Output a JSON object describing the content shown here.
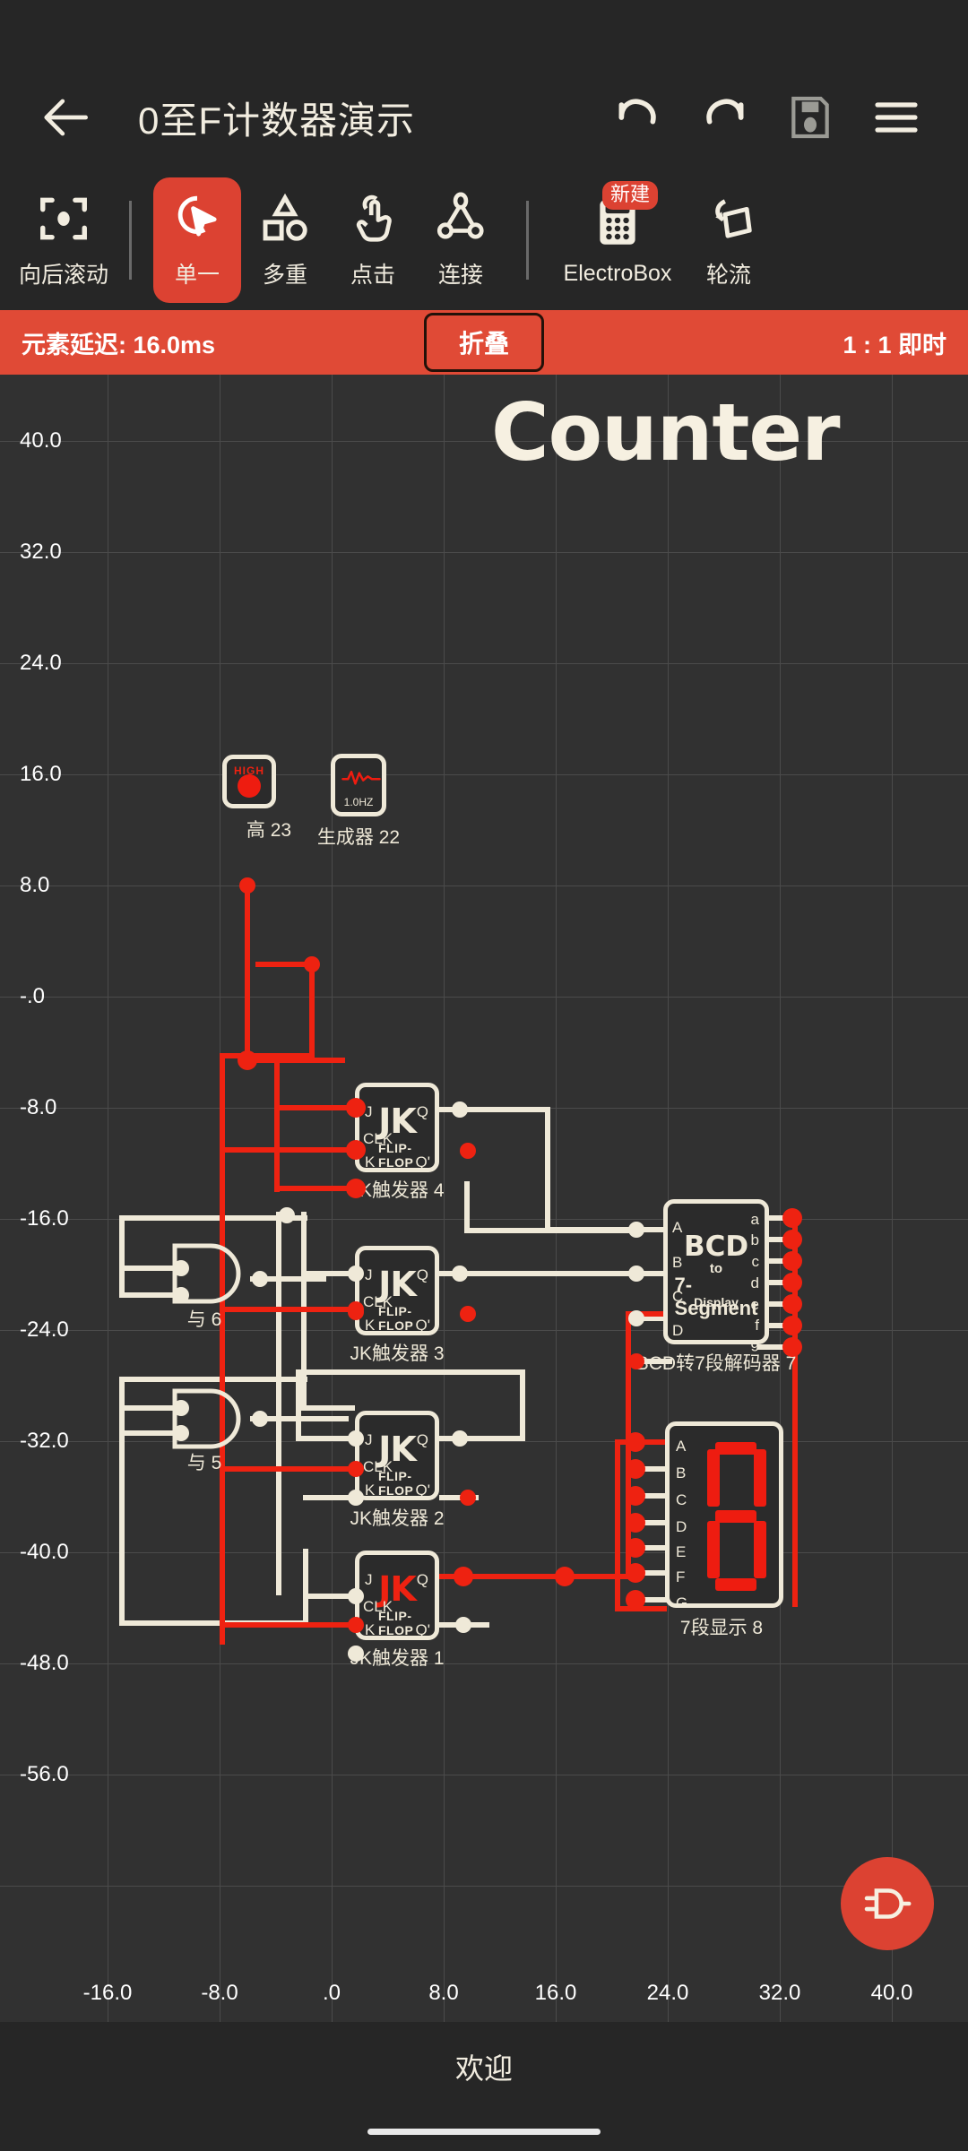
{
  "titlebar": {
    "back_icon": "arrow-left-icon",
    "title": "0至F计数器演示",
    "undo_icon": "undo-icon",
    "redo_icon": "redo-icon",
    "save_icon": "save-icon",
    "menu_icon": "hamburger-menu-icon"
  },
  "toolbar": {
    "items": [
      {
        "label": "向后滚动",
        "icon": "focus-frame-icon",
        "selected": false
      },
      {
        "label": "单一",
        "icon": "single-select-cursor-icon",
        "selected": true
      },
      {
        "label": "多重",
        "icon": "multi-shapes-icon",
        "selected": false
      },
      {
        "label": "点击",
        "icon": "tap-hand-icon",
        "selected": false
      },
      {
        "label": "连接",
        "icon": "connect-nodes-icon",
        "selected": false
      },
      {
        "label": "ElectroBox",
        "icon": "calculator-icon",
        "selected": false,
        "badge": "新建"
      },
      {
        "label": "轮流",
        "icon": "rotate-icon",
        "selected": false
      }
    ]
  },
  "simbar": {
    "delay_text": "元素延迟: 16.0ms",
    "collapse_label": "折叠",
    "rate_text": "1 : 1 即时",
    "bg_color": "#e04a36"
  },
  "canvas": {
    "sheet_title": "Counter",
    "accent_color": "#dc4232",
    "wire_color": "#efe9d8",
    "hot_color": "#ee2211",
    "y_ticks": [
      "40.0",
      "32.0",
      "24.0",
      "16.0",
      "8.0",
      "-.0",
      "-8.0",
      "-16.0",
      "-24.0",
      "-32.0",
      "-40.0",
      "-48.0",
      "-56.0"
    ],
    "x_ticks": [
      "-16.0",
      "-8.0",
      ".0",
      "8.0",
      "16.0",
      "24.0",
      "32.0",
      "40.0"
    ],
    "components": [
      {
        "name": "高 23",
        "type": "high-source",
        "badge_text": "HIGH"
      },
      {
        "name": "生成器 22",
        "type": "clock-generator",
        "freq": "1.0HZ"
      },
      {
        "name": "JK触发器 4",
        "type": "jk-flip-flop",
        "title": "JK",
        "subtitle": "FLIP-FLOP",
        "inputs": [
          "J",
          "CLK",
          "K"
        ],
        "outputs": [
          "Q",
          "Q'"
        ],
        "active": false
      },
      {
        "name": "JK触发器 3",
        "type": "jk-flip-flop",
        "title": "JK",
        "subtitle": "FLIP-FLOP",
        "inputs": [
          "J",
          "CLK",
          "K"
        ],
        "outputs": [
          "Q",
          "Q'"
        ],
        "active": false
      },
      {
        "name": "JK触发器 2",
        "type": "jk-flip-flop",
        "title": "JK",
        "subtitle": "FLIP-FLOP",
        "inputs": [
          "J",
          "CLK",
          "K"
        ],
        "outputs": [
          "Q",
          "Q'"
        ],
        "active": false
      },
      {
        "name": "JK触发器 1",
        "type": "jk-flip-flop",
        "title": "JK",
        "subtitle": "FLIP-FLOP",
        "inputs": [
          "J",
          "CLK",
          "K"
        ],
        "outputs": [
          "Q",
          "Q'"
        ],
        "active": true
      },
      {
        "name": "与 6",
        "type": "and-gate"
      },
      {
        "name": "与 5",
        "type": "and-gate"
      },
      {
        "name": "BCD转7段解码器 7",
        "type": "bcd-decoder",
        "line1": "BCD",
        "line2": "to",
        "line3": "7-Segment",
        "line4": "Display",
        "inputs": [
          "A",
          "B",
          "C",
          "D"
        ],
        "outputs": [
          "a",
          "b",
          "c",
          "d",
          "e",
          "f",
          "g"
        ]
      },
      {
        "name": "7段显示 8",
        "type": "seven-segment-display",
        "inputs": [
          "A",
          "B",
          "C",
          "D",
          "E",
          "F",
          "G"
        ],
        "value": "8"
      }
    ]
  },
  "fab": {
    "icon": "and-gate-icon"
  },
  "bottombar": {
    "label": "欢迎"
  }
}
